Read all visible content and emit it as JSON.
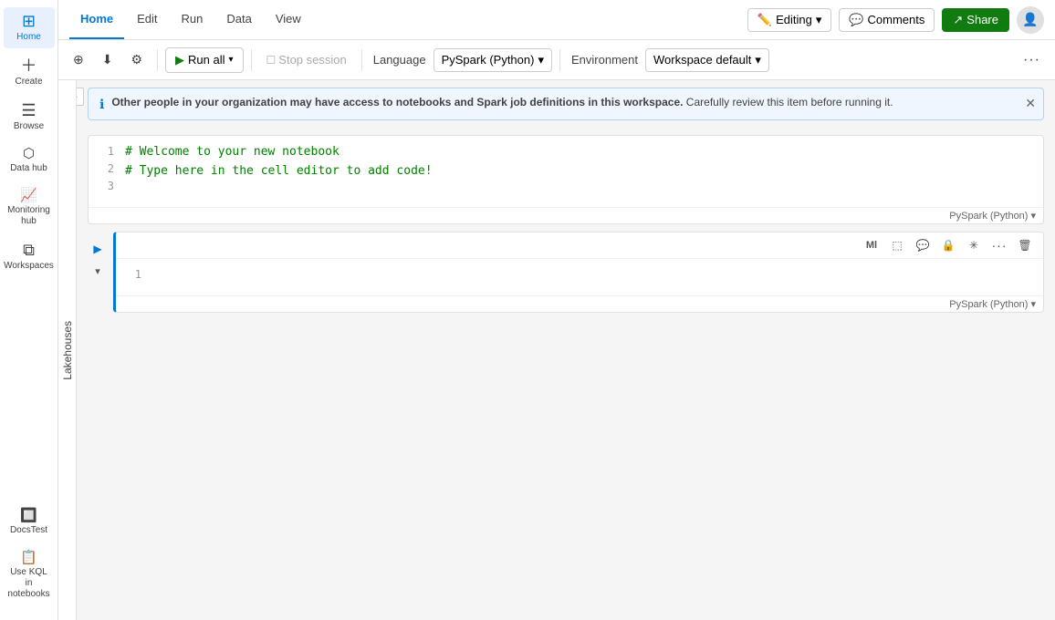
{
  "sidebar": {
    "items": [
      {
        "id": "home",
        "label": "Home",
        "icon": "⊞",
        "active": true
      },
      {
        "id": "create",
        "label": "Create",
        "icon": "＋"
      },
      {
        "id": "browse",
        "label": "Browse",
        "icon": "☰"
      },
      {
        "id": "datahub",
        "label": "Data hub",
        "icon": "⬡"
      },
      {
        "id": "monitoring",
        "label": "Monitoring hub",
        "icon": "📊"
      },
      {
        "id": "workspaces",
        "label": "Workspaces",
        "icon": "⧉"
      },
      {
        "id": "docstest",
        "label": "DocsTest",
        "icon": "🔲"
      },
      {
        "id": "kql",
        "label": "Use KQL in notebooks",
        "icon": "📋"
      }
    ]
  },
  "nav": {
    "tabs": [
      {
        "id": "home",
        "label": "Home",
        "active": true
      },
      {
        "id": "edit",
        "label": "Edit"
      },
      {
        "id": "run",
        "label": "Run"
      },
      {
        "id": "data",
        "label": "Data"
      },
      {
        "id": "view",
        "label": "View"
      }
    ]
  },
  "header": {
    "editing_label": "Editing",
    "editing_chevron": "▾",
    "comments_label": "Comments",
    "share_label": "Share"
  },
  "toolbar": {
    "add_cell_label": "Add cell",
    "save_label": "Save",
    "settings_label": "Settings",
    "run_all_label": "Run all",
    "stop_session_label": "Stop session",
    "language_label": "Language",
    "language_value": "PySpark (Python)",
    "environment_label": "Environment",
    "environment_value": "Workspace default",
    "more_label": "···"
  },
  "info_banner": {
    "bold_text": "Other people in your organization may have access to notebooks and Spark job definitions in this workspace.",
    "rest_text": " Carefully review this item before running it."
  },
  "cells": [
    {
      "id": "cell1",
      "lines": [
        {
          "num": 1,
          "code": "# Welcome to your new notebook"
        },
        {
          "num": 2,
          "code": "# Type here in the cell editor to add code!"
        },
        {
          "num": 3,
          "code": ""
        }
      ],
      "language": "PySpark (Python)"
    },
    {
      "id": "cell2",
      "lines": [
        {
          "num": 1,
          "code": ""
        }
      ],
      "language": "PySpark (Python)",
      "focused": true
    }
  ],
  "lakehouses": {
    "label": "Lakehouses"
  },
  "cell_toolbar": {
    "ml_icon": "Ml",
    "format_icon": "⬚",
    "comment_icon": "💬",
    "lock_icon": "🔒",
    "spark_icon": "✳",
    "more_icon": "···",
    "delete_icon": "🗑"
  }
}
